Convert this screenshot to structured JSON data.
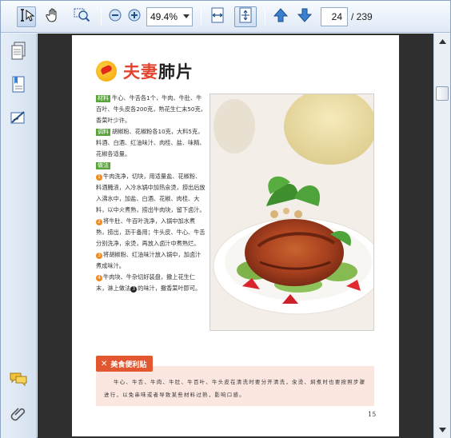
{
  "toolbar": {
    "zoom_value": "49.4%",
    "page_current": "24",
    "page_total": "/ 239",
    "icons": [
      "select-text-icon",
      "hand-tool-icon",
      "marquee-zoom-icon",
      "zoom-out-icon",
      "zoom-in-icon",
      "fit-width-icon",
      "fit-page-icon",
      "previous-page-icon",
      "next-page-icon"
    ]
  },
  "nav": {
    "icons": [
      "pages-panel-icon",
      "bookmarks-panel-icon",
      "signatures-panel-icon",
      "comments-panel-icon",
      "attachments-panel-icon"
    ]
  },
  "page": {
    "title_red": "夫妻",
    "title_black": "肺片",
    "materials_tag": "材料",
    "materials": "牛心、牛舌各1个，牛肉、牛肚、牛百叶、牛头皮各200克，熟花生仁末50克，香菜叶少许。",
    "seasoning_tag": "调料",
    "seasoning": "胡椒粉、花椒粉各10克，大料5克，料酒、白酒、红油味汁、肉桂、盐、味精、花椒各适量。",
    "method_tag": "做法",
    "steps": [
      {
        "n": "1",
        "text": "牛肉洗净，切块，用适量盐、花椒粉、料酒腌渍，入冷水锅中加热汆烫，捞出后放入沸水中，加盐、白酒、花椒、肉桂、大料，以中火煮熟，捞出牛肉块，留下卤汁。"
      },
      {
        "n": "2",
        "text": "将牛肚、牛百叶洗净，入锅中加水煮熟，捞出，沥干备用；牛头皮、牛心、牛舌分别洗净，汆烫，再放入卤汁中煮熟烂。"
      },
      {
        "n": "3",
        "text": "将胡椒粉、红油味汁放入锅中，加卤汁煮成味汁。"
      },
      {
        "n": "4",
        "text_before": "牛肉块、牛杂切好装盘，撒上花生仁末，淋上做法",
        "ref": "3",
        "text_after": "的味汁，撒香菜叶即可。"
      }
    ],
    "tip_title": "美食便利贴",
    "tip_text": "牛心、牛舌、牛肉、牛肚、牛百叶、牛头皮在清洗时要分开清洗，汆烫、焖煮时也要按照步骤进行，以免串味或者导致某些材料过熟，影响口感。",
    "page_number": "15"
  },
  "colors": {
    "toolbar_bg": "#dfe9f6",
    "doc_bg": "#2f2f2f",
    "title_red": "#e4432d",
    "tag_green": "#5aa53b",
    "tip_orange": "#e2572f",
    "tip_bg": "#fbe7e0"
  }
}
